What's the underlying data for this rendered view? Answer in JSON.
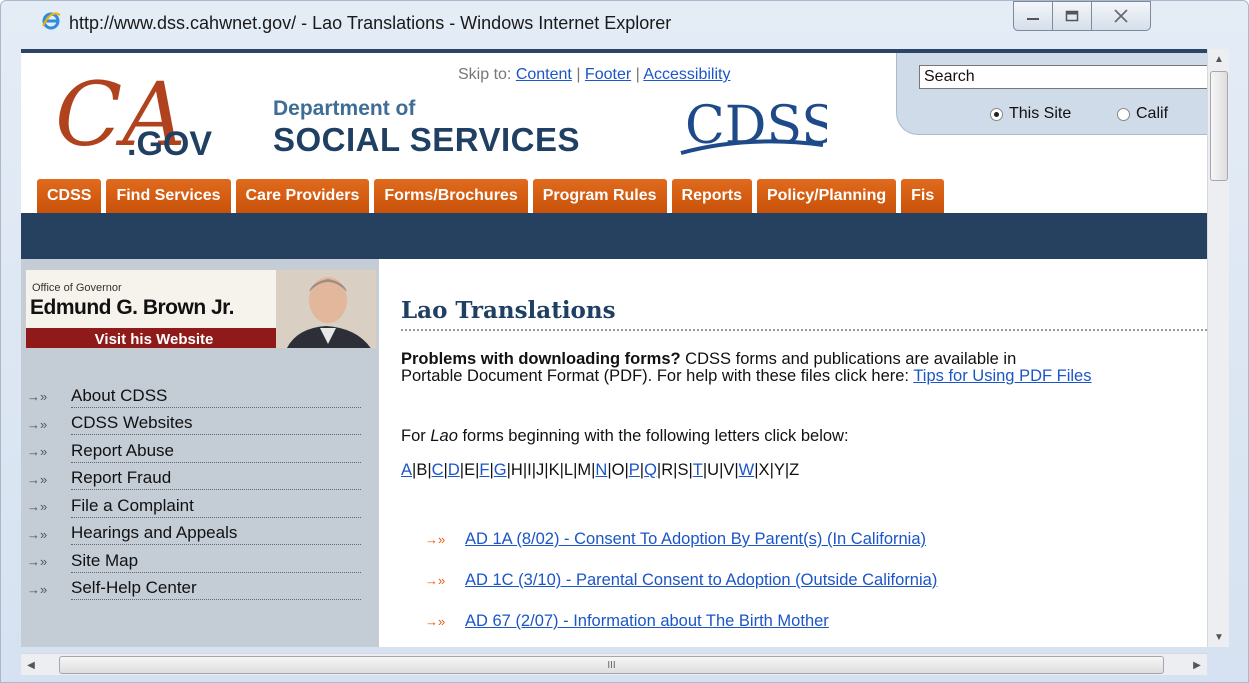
{
  "window": {
    "title": "http://www.dss.cahwnet.gov/ - Lao Translations - Windows Internet Explorer",
    "minimize_icon": "minimize-icon",
    "maximize_icon": "maximize-icon",
    "close_icon": "close-icon"
  },
  "header": {
    "ca_logo_text": "CA",
    "ca_logo_gov": ".GOV",
    "dept_of": "Department of",
    "social_services": "SOCIAL SERVICES",
    "cdss_logo": "CDSS",
    "skip_to": "Skip to:",
    "skip_content": "Content",
    "skip_footer": "Footer",
    "skip_accessibility": "Accessibility",
    "sep": "|"
  },
  "search": {
    "value": "Search",
    "radio_this_site": "This Site",
    "radio_california": "Calif"
  },
  "tabs": [
    "CDSS",
    "Find Services",
    "Care Providers",
    "Forms/Brochures",
    "Program Rules",
    "Reports",
    "Policy/Planning",
    "Fis"
  ],
  "governor": {
    "office": "Office of Governor",
    "name": "Edmund G. Brown Jr.",
    "visit": "Visit his Website"
  },
  "leftnav": [
    "About CDSS",
    "CDSS Websites",
    "Report Abuse",
    "Report Fraud",
    "File a Complaint",
    "Hearings and Appeals",
    "Site Map",
    "Self-Help Center"
  ],
  "main": {
    "title": "Lao Translations",
    "problems_bold": "Problems with downloading forms?",
    "problems_text_1": " CDSS forms and publications are available in",
    "problems_text_2": "Portable Document Format (PDF). For help with these files click here: ",
    "problems_link": "Tips for Using PDF Files",
    "for_prefix": "For ",
    "for_lang": "Lao",
    "for_suffix": " forms beginning with the following letters click below:",
    "letters": [
      {
        "l": "A",
        "link": true
      },
      {
        "l": "B",
        "link": false
      },
      {
        "l": "C",
        "link": true
      },
      {
        "l": "D",
        "link": true
      },
      {
        "l": "E",
        "link": false
      },
      {
        "l": "F",
        "link": true
      },
      {
        "l": "G",
        "link": true
      },
      {
        "l": "H",
        "link": false
      },
      {
        "l": "I",
        "link": false
      },
      {
        "l": "J",
        "link": false
      },
      {
        "l": "K",
        "link": false
      },
      {
        "l": "L",
        "link": false
      },
      {
        "l": "M",
        "link": false
      },
      {
        "l": "N",
        "link": true
      },
      {
        "l": "O",
        "link": false
      },
      {
        "l": "P",
        "link": true
      },
      {
        "l": "Q",
        "link": true
      },
      {
        "l": "R",
        "link": false
      },
      {
        "l": "S",
        "link": false
      },
      {
        "l": "T",
        "link": true
      },
      {
        "l": "U",
        "link": false
      },
      {
        "l": "V",
        "link": false
      },
      {
        "l": "W",
        "link": true
      },
      {
        "l": "X",
        "link": false
      },
      {
        "l": "Y",
        "link": false
      },
      {
        "l": "Z",
        "link": false
      }
    ],
    "forms": [
      "AD 1A (8/02) - Consent To Adoption By Parent(s) (In California)",
      "AD 1C (3/10) - Parental Consent to Adoption (Outside California)",
      "AD 67 (2/07) - Information about The Birth Mother"
    ]
  },
  "scrollbar": {
    "grip": "III"
  },
  "colors": {
    "accent_orange": "#d95e14",
    "navy": "#26405f",
    "link": "#1b55c7"
  }
}
